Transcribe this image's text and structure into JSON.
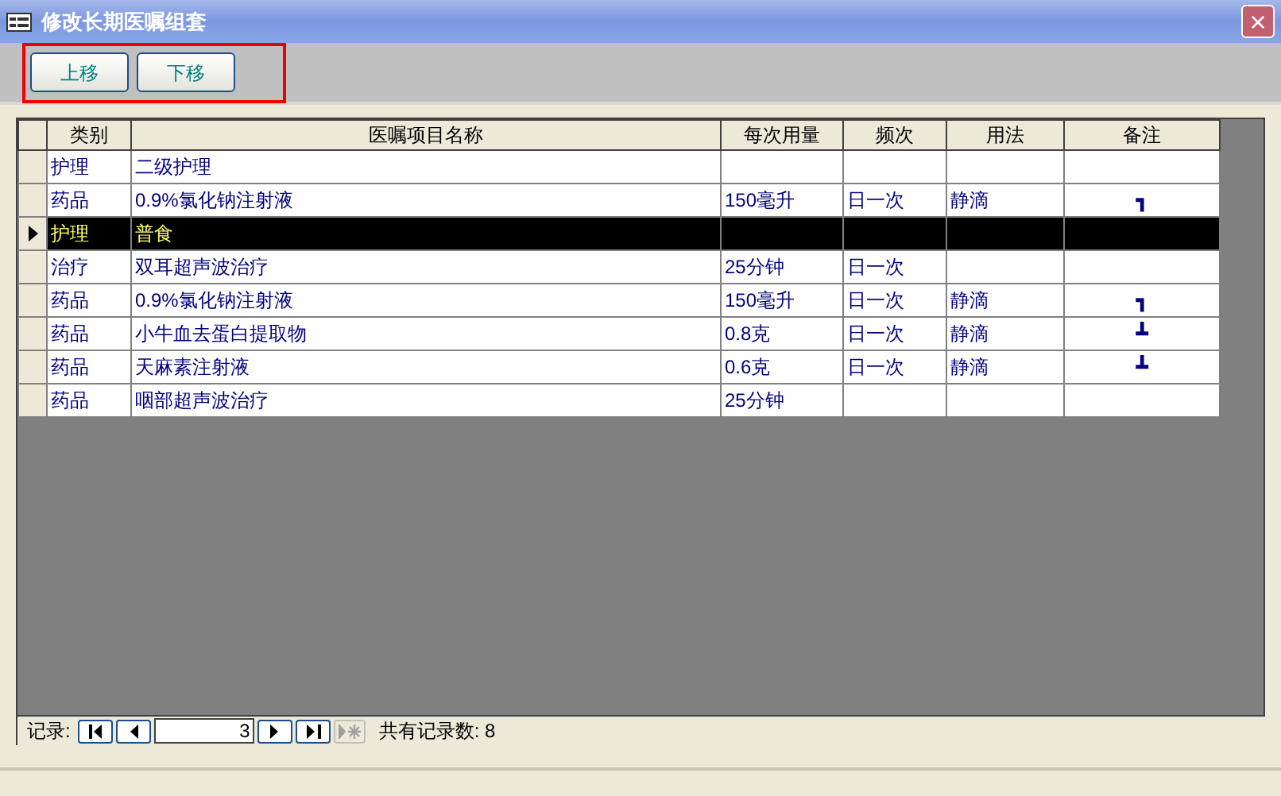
{
  "window": {
    "title": "修改长期医嘱组套",
    "close": "×"
  },
  "toolbar": {
    "buttons": [
      "上移",
      "下移"
    ]
  },
  "table": {
    "columns": [
      "类别",
      "医嘱项目名称",
      "每次用量",
      "频次",
      "用法",
      "备注"
    ],
    "rows": [
      {
        "selected": false,
        "cells": [
          "护理",
          "二级护理",
          "",
          "",
          "",
          ""
        ]
      },
      {
        "selected": false,
        "cells": [
          "药品",
          "0.9%氯化钠注射液",
          "150毫升",
          "日一次",
          "静滴",
          "┓"
        ]
      },
      {
        "selected": true,
        "cells": [
          "护理",
          "普食",
          "",
          "",
          "",
          ""
        ]
      },
      {
        "selected": false,
        "cells": [
          "治疗",
          "双耳超声波治疗",
          "25分钟",
          "日一次",
          "",
          ""
        ]
      },
      {
        "selected": false,
        "cells": [
          "药品",
          "0.9%氯化钠注射液",
          "150毫升",
          "日一次",
          "静滴",
          "┓"
        ]
      },
      {
        "selected": false,
        "cells": [
          "药品",
          "小牛血去蛋白提取物",
          "0.8克",
          "日一次",
          "静滴",
          "┻"
        ]
      },
      {
        "selected": false,
        "cells": [
          "药品",
          "天麻素注射液",
          "0.6克",
          "日一次",
          "静滴",
          "┻"
        ]
      },
      {
        "selected": false,
        "cells": [
          "药品",
          "咽部超声波治疗",
          "25分钟",
          "",
          "",
          ""
        ]
      }
    ]
  },
  "navigator": {
    "label": "记录:",
    "current": "3",
    "new_disabled": true,
    "total": "共有记录数: 8"
  }
}
